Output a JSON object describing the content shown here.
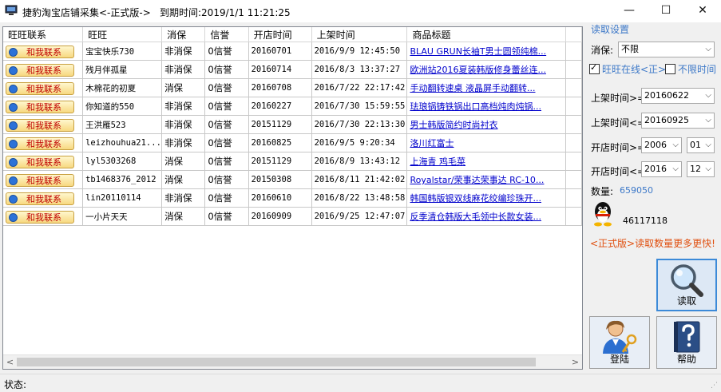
{
  "window": {
    "title": "捷豹淘宝店铺采集<-正式版->",
    "expire_text": "到期时间:2019/1/1 11:21:25",
    "minimize": "—",
    "maximize": "☐",
    "close": "✕"
  },
  "table": {
    "columns": [
      "旺旺联系",
      "旺旺",
      "消保",
      "信誉",
      "开店时间",
      "上架时间",
      "商品标题"
    ],
    "contact_label": "和我联系",
    "rows": [
      {
        "wangwang": "宝宝快乐730",
        "xiaobao": "非消保",
        "xinyu": "0信誉",
        "open": "20160701",
        "listed": "2016/9/9 12:45:50",
        "title": "BLAU  GRUN长袖T男士圆领纯棉..."
      },
      {
        "wangwang": "残月伴孤星",
        "xiaobao": "非消保",
        "xinyu": "0信誉",
        "open": "20160714",
        "listed": "2016/8/3 13:37:27",
        "title": "欧洲站2016夏装韩版修身蕾丝连..."
      },
      {
        "wangwang": "木棉花的初夏",
        "xiaobao": "消保",
        "xinyu": "0信誉",
        "open": "20160708",
        "listed": "2016/7/22 22:17:42",
        "title": "手动翻转速桌 液晶屏手动翻转..."
      },
      {
        "wangwang": "你知道的550",
        "xiaobao": "非消保",
        "xinyu": "0信誉",
        "open": "20160227",
        "listed": "2016/7/30 15:59:55",
        "title": "珐琅锅铸铁锅出口高档炖肉炖锅..."
      },
      {
        "wangwang": "王洪雁523",
        "xiaobao": "非消保",
        "xinyu": "0信誉",
        "open": "20151129",
        "listed": "2016/7/30 22:13:30",
        "title": "男士韩版简约时尚衬衣"
      },
      {
        "wangwang": "leizhouhua21...",
        "xiaobao": "非消保",
        "xinyu": "0信誉",
        "open": "20160825",
        "listed": "2016/9/5 9:20:34",
        "title": "洛川红富士"
      },
      {
        "wangwang": "lyl5303268",
        "xiaobao": "消保",
        "xinyu": "0信誉",
        "open": "20151129",
        "listed": "2016/8/9 13:43:12",
        "title": "上海青 鸡毛菜"
      },
      {
        "wangwang": "tb1468376_2012",
        "xiaobao": "消保",
        "xinyu": "0信誉",
        "open": "20150308",
        "listed": "2016/8/11 21:42:02",
        "title": "Royalstar/荣事达荣事达 RC-10..."
      },
      {
        "wangwang": "lin20110114",
        "xiaobao": "非消保",
        "xinyu": "0信誉",
        "open": "20160610",
        "listed": "2016/8/22 13:48:58",
        "title": "韩国韩版银双线麻花绞编珍珠开..."
      },
      {
        "wangwang": "一小片天天",
        "xiaobao": "消保",
        "xinyu": "0信誉",
        "open": "20160909",
        "listed": "2016/9/25 12:47:07",
        "title": "反季清仓韩版大毛领中长款女装..."
      }
    ]
  },
  "scrollbar": {
    "left": "<",
    "right": ">"
  },
  "status": {
    "label": "状态:"
  },
  "panel": {
    "group_title": "读取设置",
    "xiaobao_label": "消保:",
    "xiaobao_value": "不限",
    "online_label": "旺旺在线<正>",
    "online_checked": true,
    "unlimited_time_label": "不限时间",
    "unlimited_time_checked": false,
    "listed_from_label": "上架时间>=",
    "listed_from_value": "20160622",
    "listed_to_label": "上架时间<=",
    "listed_to_value": "20160925",
    "open_from_label": "开店时间>=",
    "open_from_year": "2006",
    "open_from_month": "01",
    "open_to_label": "开店时间<=",
    "open_to_year": "2016",
    "open_to_month": "12",
    "count_label": "数量:",
    "count_value": "659050",
    "qq_number": "46117118",
    "promo": "<正式版>读取数量更多更快!",
    "read_button": "读取",
    "login_button": "登陆",
    "help_button": "帮助"
  },
  "colors": {
    "accent": "#3c78c8",
    "promo": "#e05010",
    "link": "#0000cc"
  }
}
